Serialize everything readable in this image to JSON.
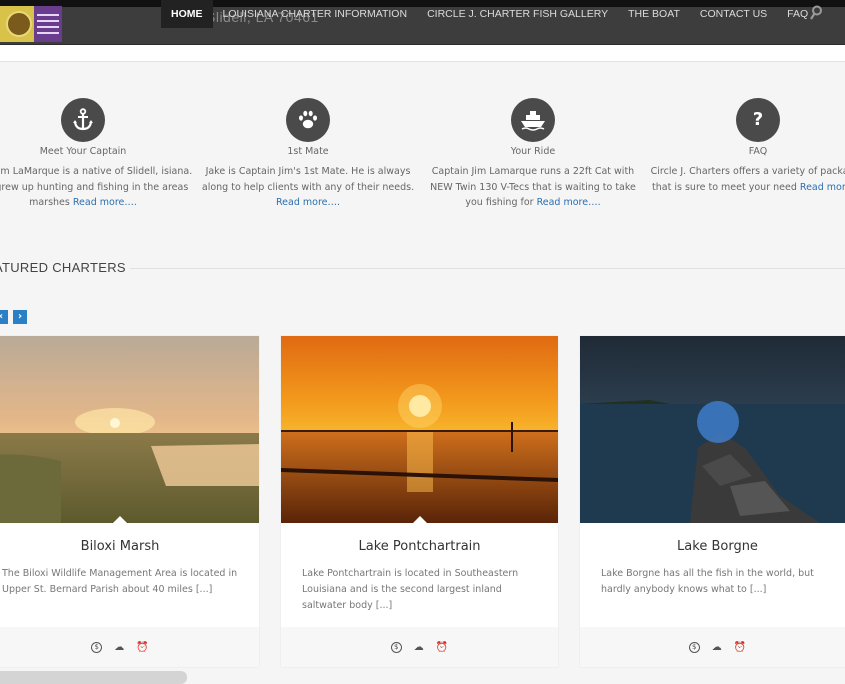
{
  "header": {
    "ghost_address": "Slidell, LA 70461",
    "nav": [
      {
        "label": "Home",
        "active": true
      },
      {
        "label": "Louisiana Charter Information"
      },
      {
        "label": "Circle J. Charter Fish Gallery"
      },
      {
        "label": "The Boat"
      },
      {
        "label": "Contact Us"
      },
      {
        "label": "FAQ"
      }
    ]
  },
  "features": [
    {
      "icon": "anchor-icon",
      "title": "Meet Your Captain",
      "text": "tian Jim LaMarque is a native of Slidell, isiana. Jim grew up hunting and fishing in the areas marshes",
      "more": "Read more…."
    },
    {
      "icon": "paw-icon",
      "title": "1st Mate",
      "text": "Jake is Captain Jim's 1st Mate. He is always along to help clients with any of their needs.",
      "more": "Read more…."
    },
    {
      "icon": "boat-icon",
      "title": "Your Ride",
      "text": "Captain Jim Lamarque runs a 22ft Cat with NEW Twin 130 V-Tecs that is waiting to take you fishing for",
      "more": "Read more…."
    },
    {
      "icon": "question-icon",
      "title": "FAQ",
      "text": "Circle J. Charters offers a variety of packages that is sure to meet your need",
      "more": "Read more…."
    }
  ],
  "featured": {
    "title": "ATURED CHARTERS",
    "prev": "‹",
    "next": "›"
  },
  "cards": [
    {
      "title": "Biloxi Marsh",
      "desc": "The Biloxi Wildlife Management Area is located in Upper St. Bernard Parish about 40 miles [...]"
    },
    {
      "title": "Lake Pontchartrain",
      "desc": "Lake Pontchartrain is located in Southeastern Louisiana and is the second largest inland saltwater body [...]"
    },
    {
      "title": "Lake Borgne",
      "desc": "Lake Borgne has all the fish in the world, but hardly anybody knows what to [...]"
    }
  ],
  "card_footer_icons": {
    "price": "$"
  },
  "colors": {
    "accent": "#2b7fc4",
    "header": "#3d3d3d",
    "icon_circle": "#4a4a4a"
  }
}
